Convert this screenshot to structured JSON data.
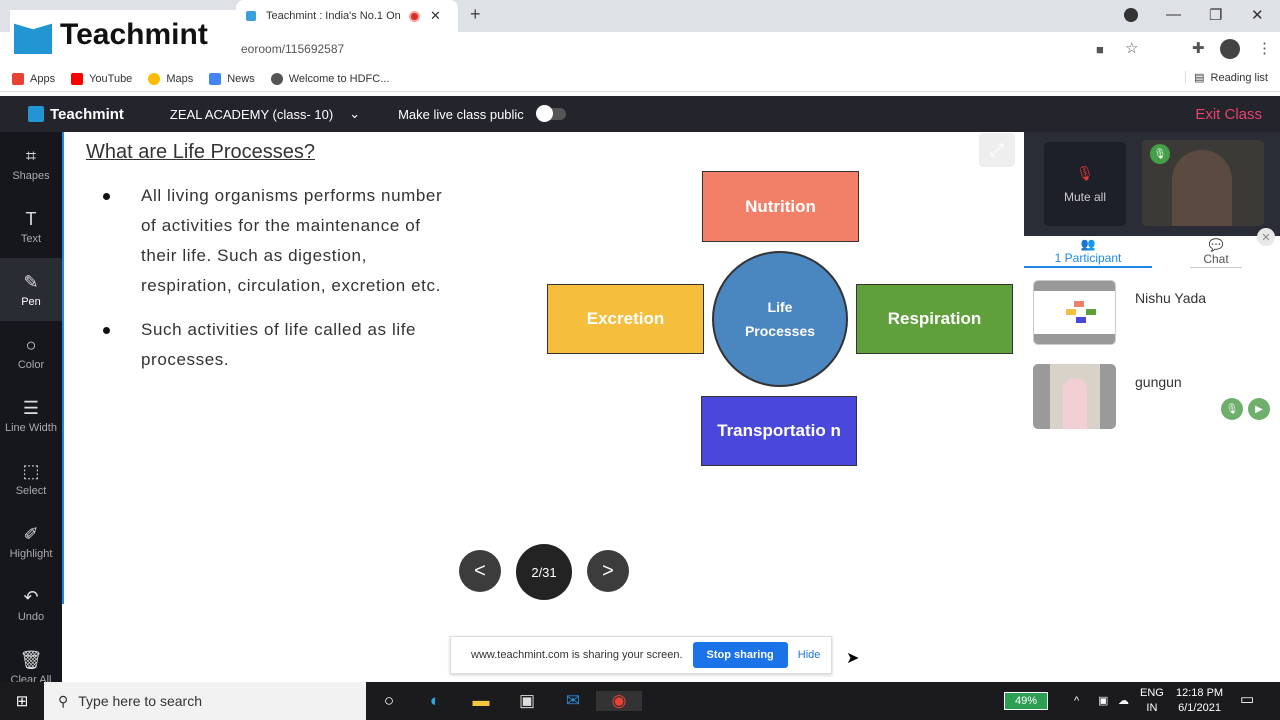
{
  "browser": {
    "tab_title": "Teachmint : India's No.1 Onl",
    "new_tab": "+",
    "url": "eoroom/115692587",
    "bookmarks": [
      {
        "label": "Apps",
        "icon": "apps-grid-icon",
        "color": "#e94235"
      },
      {
        "label": "YouTube",
        "icon": "youtube-icon",
        "color": "#ff0000"
      },
      {
        "label": "Maps",
        "icon": "maps-icon",
        "color": "#fbbc04"
      },
      {
        "label": "News",
        "icon": "news-icon",
        "color": "#4285f4"
      },
      {
        "label": "Welcome to HDFC...",
        "icon": "globe-icon",
        "color": "#555555"
      }
    ],
    "reading_list": "Reading list"
  },
  "overlay_logo": "Teachmint",
  "app": {
    "brand": "Teachmint",
    "class_selector": "ZEAL ACADEMY (class- 10)",
    "make_public_label": "Make live class public",
    "make_public_on": false,
    "exit_label": "Exit Class",
    "exit_color": "#e8416b"
  },
  "tools": [
    {
      "label": "Shapes",
      "icon": "⌗",
      "name": "shapes"
    },
    {
      "label": "Text",
      "icon": "T",
      "name": "text"
    },
    {
      "label": "Pen",
      "icon": "✎",
      "name": "pen",
      "active": true
    },
    {
      "label": "Color",
      "icon": "○",
      "name": "color"
    },
    {
      "label": "Line Width",
      "icon": "☰",
      "name": "line-width"
    },
    {
      "label": "Select",
      "icon": "⬚",
      "name": "select"
    },
    {
      "label": "Highlight",
      "icon": "✐",
      "name": "highlight"
    },
    {
      "label": "Undo",
      "icon": "↶",
      "name": "undo"
    },
    {
      "label": "Clear All",
      "icon": "🗑",
      "name": "clear-all"
    }
  ],
  "slide": {
    "title": "What are Life Processes?",
    "bullets": [
      [
        "All living organisms performs number",
        "of activities for the maintenance of",
        "their life. Such as digestion,",
        "respiration, circulation, excretion etc."
      ],
      [
        "Such activities of life called as life",
        "processes."
      ]
    ],
    "diagram": {
      "center": [
        "Life",
        "Processes"
      ],
      "nodes": [
        {
          "label": "Nutrition",
          "color": "#f28068"
        },
        {
          "label": "Excretion",
          "color": "#f5be3d"
        },
        {
          "label": "Respiration",
          "color": "#5fa03c"
        },
        {
          "label": "Transportatio n",
          "color": "#4a48dc"
        }
      ]
    },
    "page_indicator": "2/31",
    "prev": "<",
    "next": ">"
  },
  "sharebar": {
    "message": "www.teachmint.com is sharing your screen.",
    "stop": "Stop sharing",
    "hide": "Hide"
  },
  "participants_panel": {
    "mute_all": "Mute all",
    "tab_participants": "1 Participant",
    "tab_chat": "Chat",
    "participants": [
      {
        "name": "Nishu Yada"
      },
      {
        "name": "gungun"
      }
    ]
  },
  "taskbar": {
    "search_placeholder": "Type here to search",
    "battery": "49%",
    "lang1": "ENG",
    "lang2": "IN",
    "time": "12:18 PM",
    "date": "6/1/2021"
  }
}
